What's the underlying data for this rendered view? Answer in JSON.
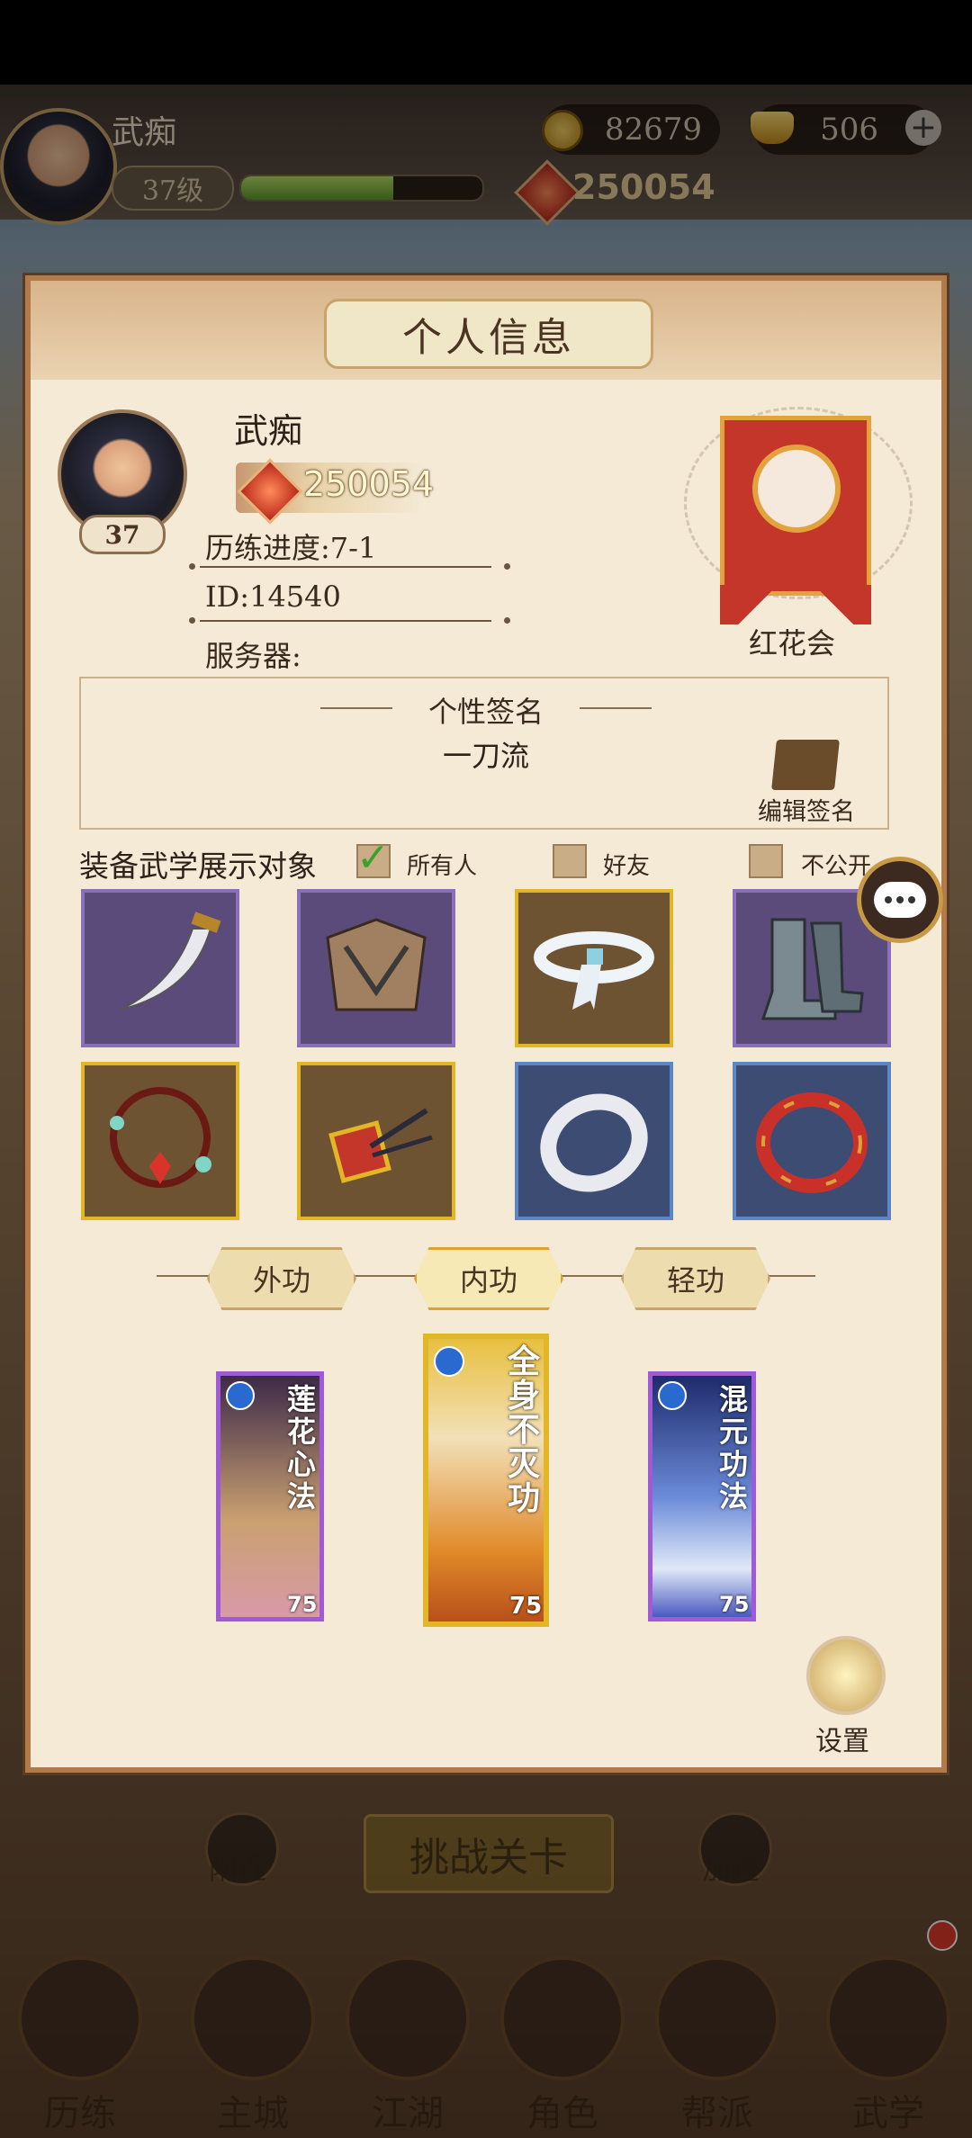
{
  "top": {
    "player_name": "武痴",
    "level": "37级",
    "xp_fraction": 0.63,
    "coins": "82679",
    "ingots": "506",
    "power": "250054"
  },
  "panel": {
    "title": "个人信息",
    "name": "武痴",
    "level": "37",
    "power": "250054",
    "progress": "历练进度:7-1",
    "id": "ID:14540",
    "server": "服务器:",
    "guild": "红花会",
    "signature_title": "个性签名",
    "signature": "一刀流",
    "edit_signature": "编辑签名",
    "visibility_label": "装备武学展示对象",
    "visibility_options": [
      {
        "label": "所有人",
        "checked": true
      },
      {
        "label": "好友",
        "checked": false
      },
      {
        "label": "不公开",
        "checked": false
      }
    ],
    "equipment": [
      {
        "icon": "saber-icon",
        "frame": "purple"
      },
      {
        "icon": "armor-icon",
        "frame": "purple"
      },
      {
        "icon": "belt-icon",
        "frame": "gold"
      },
      {
        "icon": "boots-icon",
        "frame": "purple"
      },
      {
        "icon": "necklace-icon",
        "frame": "gold"
      },
      {
        "icon": "hairpin-icon",
        "frame": "gold"
      },
      {
        "icon": "silver-ring-icon",
        "frame": "blue"
      },
      {
        "icon": "red-bangle-icon",
        "frame": "blue"
      }
    ],
    "tabs": [
      "外功",
      "内功",
      "轻功"
    ],
    "active_tab": 1,
    "skills": [
      {
        "name": "莲花心法",
        "level": "75"
      },
      {
        "name": "全身不灭功",
        "level": "75"
      },
      {
        "name": "混元功法",
        "level": "75"
      }
    ],
    "settings_label": "设置"
  },
  "bottom": {
    "challenge": "挑战关卡",
    "nearby": "附近",
    "speedup": "加速",
    "nav": [
      "历练",
      "主城",
      "江湖",
      "角色",
      "帮派",
      "武学"
    ]
  },
  "colors": {
    "panel_bg": "#f4ead6",
    "guild_banner": "#c4362a",
    "gold_frame": "#e2b626"
  }
}
